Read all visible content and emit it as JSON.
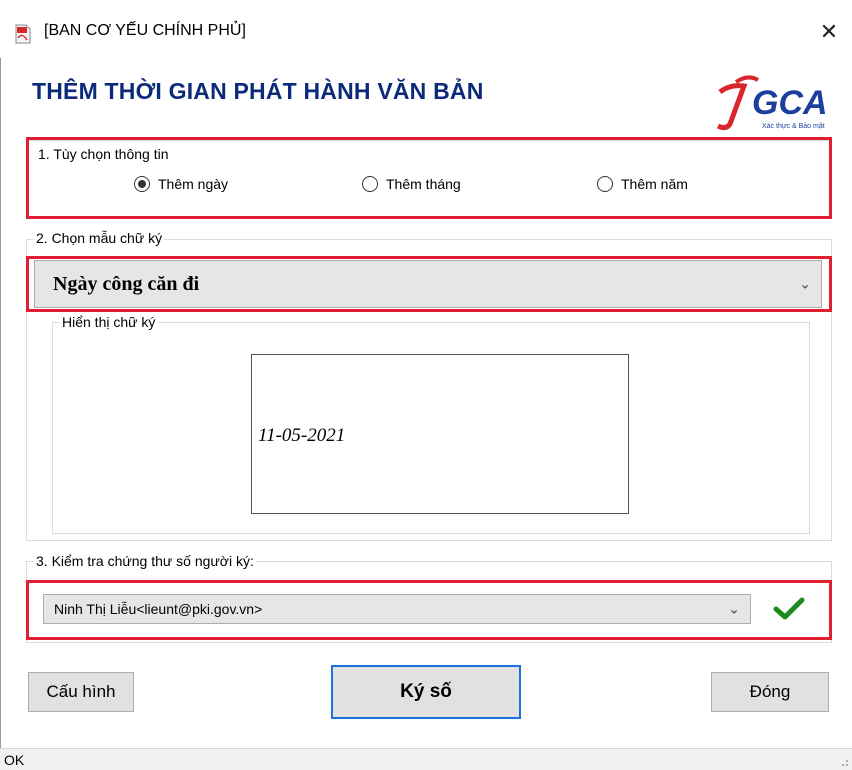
{
  "window": {
    "title": "[BAN CƠ YẾU CHÍNH PHỦ]",
    "close_symbol": "✕"
  },
  "heading": "THÊM THỜI GIAN PHÁT HÀNH VĂN BẢN",
  "logo": {
    "text": "GCA",
    "tagline": "Xác thực & Bảo mật"
  },
  "options_group": {
    "label": "1. Tùy chọn thông tin",
    "radios": [
      {
        "label": "Thêm ngày",
        "checked": true
      },
      {
        "label": "Thêm tháng",
        "checked": false
      },
      {
        "label": "Thêm năm",
        "checked": false
      }
    ]
  },
  "signature_group": {
    "label": "2. Chọn mẫu chữ ký",
    "selected_template": "Ngày công căn đi",
    "preview_label": "Hiển thị chữ ký",
    "preview_date": "11-05-2021"
  },
  "certificate_group": {
    "label": "3. Kiểm tra chứng thư số người ký:",
    "selected_certificate": "Ninh Thị Liễu<lieunt@pki.gov.vn>",
    "valid": true
  },
  "buttons": {
    "config": "Cấu hình",
    "sign": "Ký số",
    "close": "Đóng"
  },
  "status": "OK",
  "colors": {
    "heading": "#0b2a7a",
    "highlight": "#e02030",
    "check": "#1e8a1e",
    "primary_border": "#1a73d9"
  }
}
